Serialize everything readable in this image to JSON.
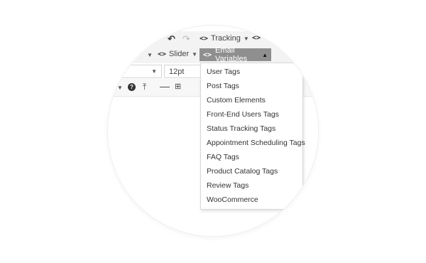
{
  "toolbar": {
    "row1": {
      "tracking_label": "Tracking"
    },
    "row2": {
      "slider_label": "Slider",
      "email_variables_label": "Email Variables"
    },
    "row3": {
      "font_size_value": "12pt"
    }
  },
  "email_variables_menu": {
    "items": [
      "User Tags",
      "Post Tags",
      "Custom Elements",
      "Front-End Users Tags",
      "Status Tracking Tags",
      "Appointment Scheduling Tags",
      "FAQ Tags",
      "Product Catalog Tags",
      "Review Tags",
      "WooCommerce"
    ]
  },
  "icons": {
    "undo": "undo-icon",
    "redo": "redo-icon",
    "code": "code-icon",
    "help": "help-icon",
    "upload": "upload-icon",
    "horizontal_rule": "horizontal-rule-icon",
    "page_break": "page-break-icon"
  },
  "colors": {
    "toolbar_bg": "#f3f3f3",
    "active_button_bg": "#8f8f8f",
    "menu_bg": "#ffffff"
  }
}
